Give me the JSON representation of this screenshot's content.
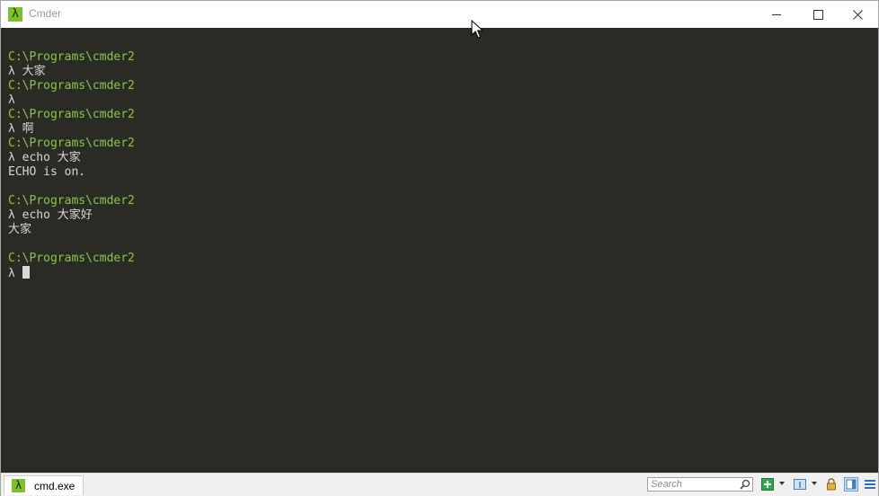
{
  "window": {
    "title": "Cmder",
    "app_icon": "lambda-icon",
    "controls": {
      "minimize": "minimize-icon",
      "maximize": "maximize-icon",
      "close": "close-icon"
    }
  },
  "console": {
    "lines": [
      {
        "kind": "path",
        "text": "C:\\Programs\\cmder2"
      },
      {
        "kind": "out",
        "text": "λ 大家"
      },
      {
        "kind": "path",
        "text": "C:\\Programs\\cmder2"
      },
      {
        "kind": "out",
        "text": "λ"
      },
      {
        "kind": "path",
        "text": "C:\\Programs\\cmder2"
      },
      {
        "kind": "out",
        "text": "λ 啊"
      },
      {
        "kind": "path",
        "text": "C:\\Programs\\cmder2"
      },
      {
        "kind": "out",
        "text": "λ echo 大家"
      },
      {
        "kind": "out",
        "text": "ECHO is on."
      },
      {
        "kind": "out",
        "text": ""
      },
      {
        "kind": "path",
        "text": "C:\\Programs\\cmder2"
      },
      {
        "kind": "out",
        "text": "λ echo 大家好"
      },
      {
        "kind": "out",
        "text": "大家"
      },
      {
        "kind": "out",
        "text": ""
      },
      {
        "kind": "path",
        "text": "C:\\Programs\\cmder2"
      }
    ],
    "prompt": "λ ",
    "colors": {
      "background": "#2b2b25",
      "path": "#8bc34a",
      "text": "#d6d6d6"
    }
  },
  "statusbar": {
    "tab_label": "cmd.exe",
    "search_placeholder": "Search",
    "icons": [
      "add-console-icon",
      "split-view-icon",
      "lock-icon",
      "panel-view-icon",
      "menu-icon"
    ]
  }
}
